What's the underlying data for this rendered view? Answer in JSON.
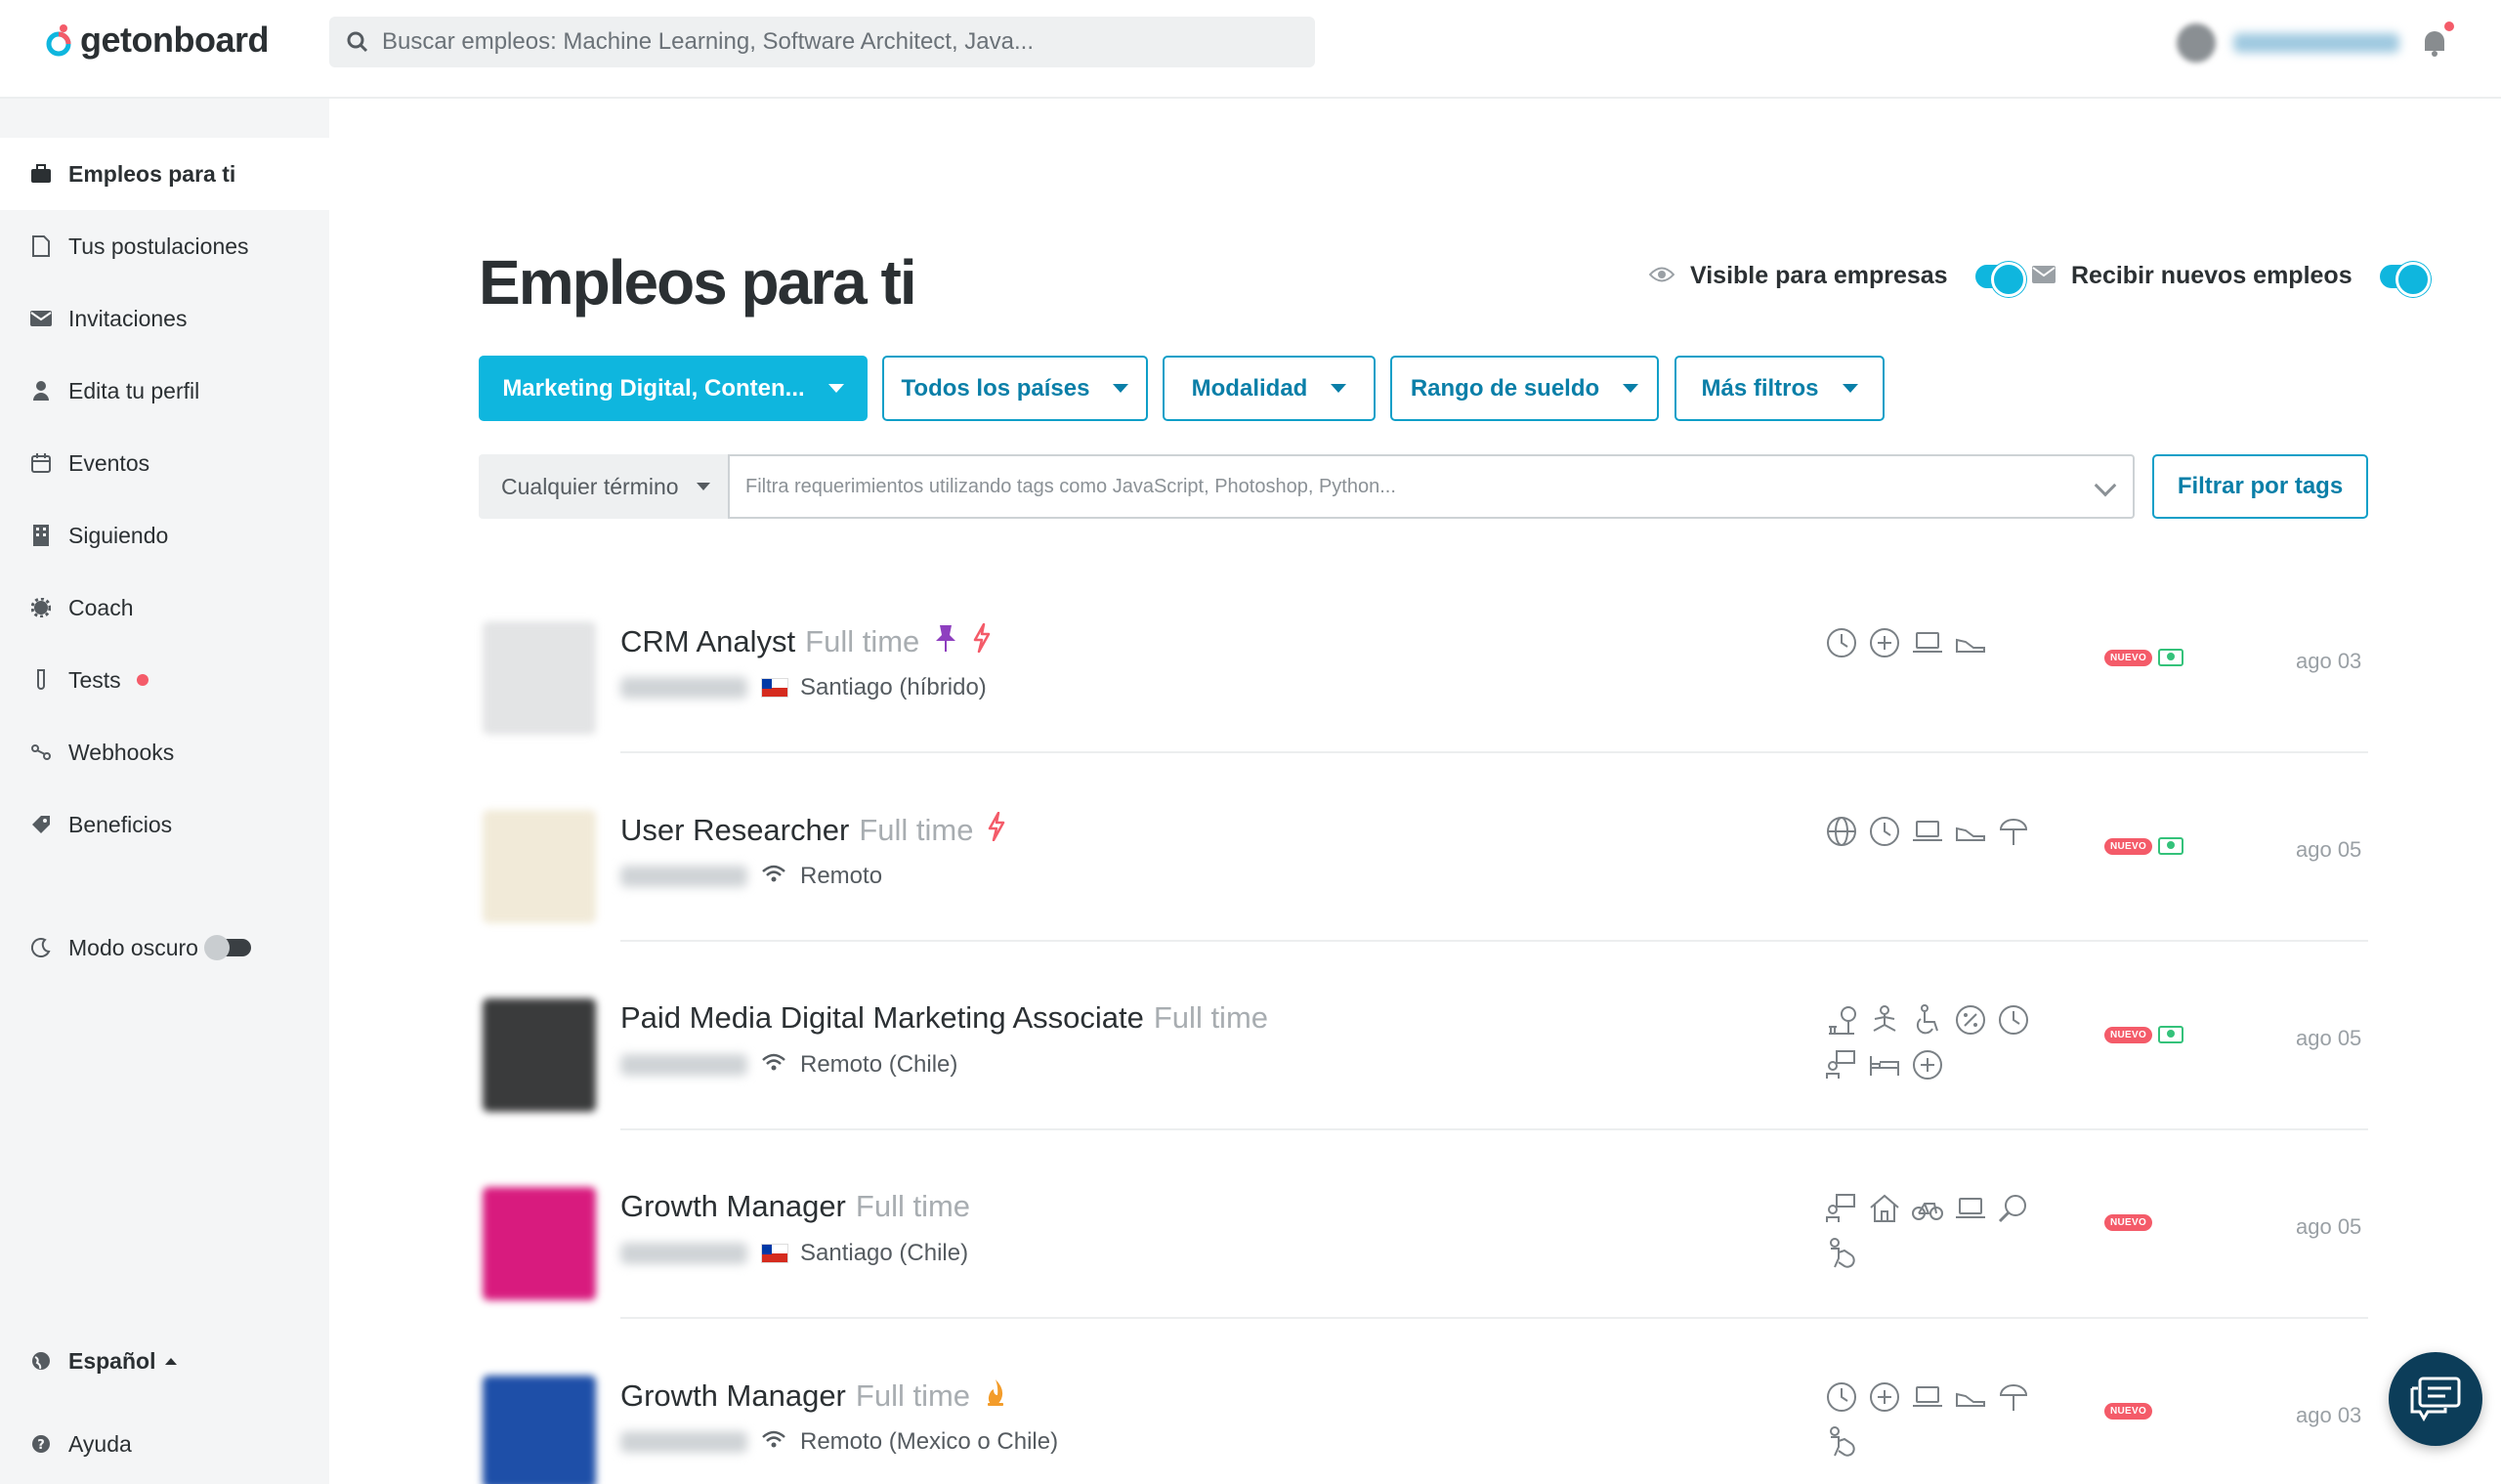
{
  "brand": {
    "name": "getonboard",
    "colors": {
      "accent": "#0fb6de",
      "accent_dark": "#0a7fa8",
      "badge": "#f45b69",
      "money": "#34c27a"
    }
  },
  "search": {
    "placeholder": "Buscar empleos: Machine Learning, Software Architect, Java..."
  },
  "sidebar": {
    "items": [
      {
        "label": "Empleos para ti",
        "icon": "briefcase-icon",
        "active": true
      },
      {
        "label": "Tus postulaciones",
        "icon": "document-icon"
      },
      {
        "label": "Invitaciones",
        "icon": "envelope-icon"
      },
      {
        "label": "Edita tu perfil",
        "icon": "user-icon"
      },
      {
        "label": "Eventos",
        "icon": "calendar-icon"
      },
      {
        "label": "Siguiendo",
        "icon": "building-icon"
      },
      {
        "label": "Coach",
        "icon": "gear-icon"
      },
      {
        "label": "Tests",
        "icon": "test-tube-icon",
        "has_dot": true
      },
      {
        "label": "Webhooks",
        "icon": "webhook-icon"
      },
      {
        "label": "Beneficios",
        "icon": "tag-icon"
      }
    ],
    "dark_mode": {
      "label": "Modo oscuro",
      "icon": "moon-icon"
    },
    "language": {
      "label": "Español",
      "icon": "globe-icon"
    },
    "help": {
      "label": "Ayuda",
      "icon": "help-icon"
    }
  },
  "main": {
    "title": "Empleos para ti",
    "visible_label": "Visible para empresas",
    "receive_label": "Recibir nuevos empleos",
    "filters": [
      {
        "label": "Marketing Digital, Conten...",
        "primary": true
      },
      {
        "label": "Todos los países"
      },
      {
        "label": "Modalidad"
      },
      {
        "label": "Rango de sueldo"
      },
      {
        "label": "Más filtros"
      }
    ],
    "term_select": "Cualquier término",
    "tags_placeholder": "Filtra requerimientos utilizando tags como JavaScript, Photoshop, Python...",
    "tags_button": "Filtrar por tags"
  },
  "jobs": [
    {
      "title": "CRM Analyst",
      "modality": "Full time",
      "location": "Santiago (híbrido)",
      "location_icon": "chile-flag",
      "flags": [
        "pin-icon",
        "lightning-icon"
      ],
      "benefits": [
        "clock-icon",
        "health-icon",
        "laptop-icon",
        "shoe-icon"
      ],
      "nuevo": "NUEVO",
      "salary": true,
      "date": "ago 03",
      "logo_color": "#e3e4e5"
    },
    {
      "title": "User Researcher",
      "modality": "Full time",
      "location": "Remoto",
      "location_icon": "wifi",
      "flags": [
        "lightning-icon"
      ],
      "benefits": [
        "globe-icon",
        "clock-icon",
        "laptop-icon",
        "shoe-icon",
        "beach-icon"
      ],
      "nuevo": "NUEVO",
      "salary": true,
      "date": "ago 05",
      "logo_color": "#f1ead8"
    },
    {
      "title": "Paid Media Digital Marketing Associate",
      "modality": "Full time",
      "location": "Remoto (Chile)",
      "location_icon": "wifi",
      "flags": [],
      "benefits": [
        "tree-icon",
        "meditation-icon",
        "accessibility-icon",
        "percent-icon",
        "clock-icon",
        "mentoring-icon",
        "bed-icon",
        "health-icon"
      ],
      "nuevo": "NUEVO",
      "salary": true,
      "date": "ago 05",
      "logo_color": "#3a3b3c"
    },
    {
      "title": "Growth Manager",
      "modality": "Full time",
      "location": "Santiago (Chile)",
      "location_icon": "chile-flag",
      "flags": [],
      "benefits": [
        "mentoring-icon",
        "home-icon",
        "bike-icon",
        "laptop-icon",
        "search-icon",
        "baby-icon"
      ],
      "nuevo": "NUEVO",
      "salary": false,
      "date": "ago 05",
      "logo_color": "#d81b7e"
    },
    {
      "title": "Growth Manager",
      "modality": "Full time",
      "location": "Remoto (Mexico o Chile)",
      "location_icon": "wifi",
      "flags": [
        "fire-icon"
      ],
      "benefits": [
        "clock-icon",
        "health-icon",
        "laptop-icon",
        "shoe-icon",
        "beach-icon",
        "baby-icon"
      ],
      "nuevo": "NUEVO",
      "salary": false,
      "date": "ago 03",
      "logo_color": "#1e4fa8"
    }
  ]
}
